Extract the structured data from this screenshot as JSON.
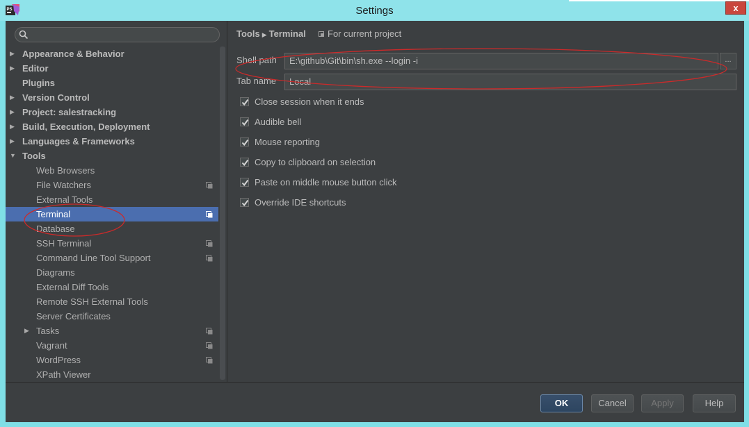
{
  "window": {
    "title": "Settings",
    "close_glyph": "x"
  },
  "sidebar": {
    "search_placeholder": "",
    "items": [
      {
        "label": "Appearance & Behavior",
        "level": 0,
        "expandable": true,
        "expanded": false,
        "project_icon": false
      },
      {
        "label": "Editor",
        "level": 0,
        "expandable": true,
        "expanded": false,
        "project_icon": false
      },
      {
        "label": "Plugins",
        "level": 0,
        "expandable": false,
        "expanded": false,
        "project_icon": false
      },
      {
        "label": "Version Control",
        "level": 0,
        "expandable": true,
        "expanded": false,
        "project_icon": false
      },
      {
        "label": "Project: salestracking",
        "level": 0,
        "expandable": true,
        "expanded": false,
        "project_icon": false
      },
      {
        "label": "Build, Execution, Deployment",
        "level": 0,
        "expandable": true,
        "expanded": false,
        "project_icon": false
      },
      {
        "label": "Languages & Frameworks",
        "level": 0,
        "expandable": true,
        "expanded": false,
        "project_icon": false
      },
      {
        "label": "Tools",
        "level": 0,
        "expandable": true,
        "expanded": true,
        "project_icon": false
      },
      {
        "label": "Web Browsers",
        "level": 1,
        "expandable": false,
        "expanded": false,
        "project_icon": false
      },
      {
        "label": "File Watchers",
        "level": 1,
        "expandable": false,
        "expanded": false,
        "project_icon": true
      },
      {
        "label": "External Tools",
        "level": 1,
        "expandable": false,
        "expanded": false,
        "project_icon": false
      },
      {
        "label": "Terminal",
        "level": 1,
        "expandable": false,
        "expanded": false,
        "project_icon": true,
        "selected": true
      },
      {
        "label": "Database",
        "level": 1,
        "expandable": false,
        "expanded": false,
        "project_icon": false
      },
      {
        "label": "SSH Terminal",
        "level": 1,
        "expandable": false,
        "expanded": false,
        "project_icon": true
      },
      {
        "label": "Command Line Tool Support",
        "level": 1,
        "expandable": false,
        "expanded": false,
        "project_icon": true
      },
      {
        "label": "Diagrams",
        "level": 1,
        "expandable": false,
        "expanded": false,
        "project_icon": false
      },
      {
        "label": "External Diff Tools",
        "level": 1,
        "expandable": false,
        "expanded": false,
        "project_icon": false
      },
      {
        "label": "Remote SSH External Tools",
        "level": 1,
        "expandable": false,
        "expanded": false,
        "project_icon": false
      },
      {
        "label": "Server Certificates",
        "level": 1,
        "expandable": false,
        "expanded": false,
        "project_icon": false
      },
      {
        "label": "Tasks",
        "level": 1,
        "expandable": true,
        "expanded": false,
        "project_icon": true
      },
      {
        "label": "Vagrant",
        "level": 1,
        "expandable": false,
        "expanded": false,
        "project_icon": true
      },
      {
        "label": "WordPress",
        "level": 1,
        "expandable": false,
        "expanded": false,
        "project_icon": true
      },
      {
        "label": "XPath Viewer",
        "level": 1,
        "expandable": false,
        "expanded": false,
        "project_icon": false
      }
    ]
  },
  "main": {
    "breadcrumb": [
      "Tools",
      "Terminal"
    ],
    "scope_label": "For current project",
    "shell_path": {
      "label": "Shell path",
      "value": "E:\\github\\Git\\bin\\sh.exe --login -i"
    },
    "tab_name": {
      "label": "Tab name",
      "value": "Local"
    },
    "browse_label": "...",
    "options": [
      {
        "label": "Close session when it ends",
        "checked": true
      },
      {
        "label": "Audible bell",
        "checked": true
      },
      {
        "label": "Mouse reporting",
        "checked": true
      },
      {
        "label": "Copy to clipboard on selection",
        "checked": true
      },
      {
        "label": "Paste on middle mouse button click",
        "checked": true
      },
      {
        "label": "Override IDE shortcuts",
        "checked": true
      }
    ]
  },
  "buttons": {
    "ok": "OK",
    "cancel": "Cancel",
    "apply": "Apply",
    "help": "Help"
  },
  "colors": {
    "background": "#3c3f41",
    "selection": "#4b6eaf",
    "text": "#bbbbbb",
    "annotation": "#cc2a2a",
    "titlebar": "#8fe3ea"
  }
}
